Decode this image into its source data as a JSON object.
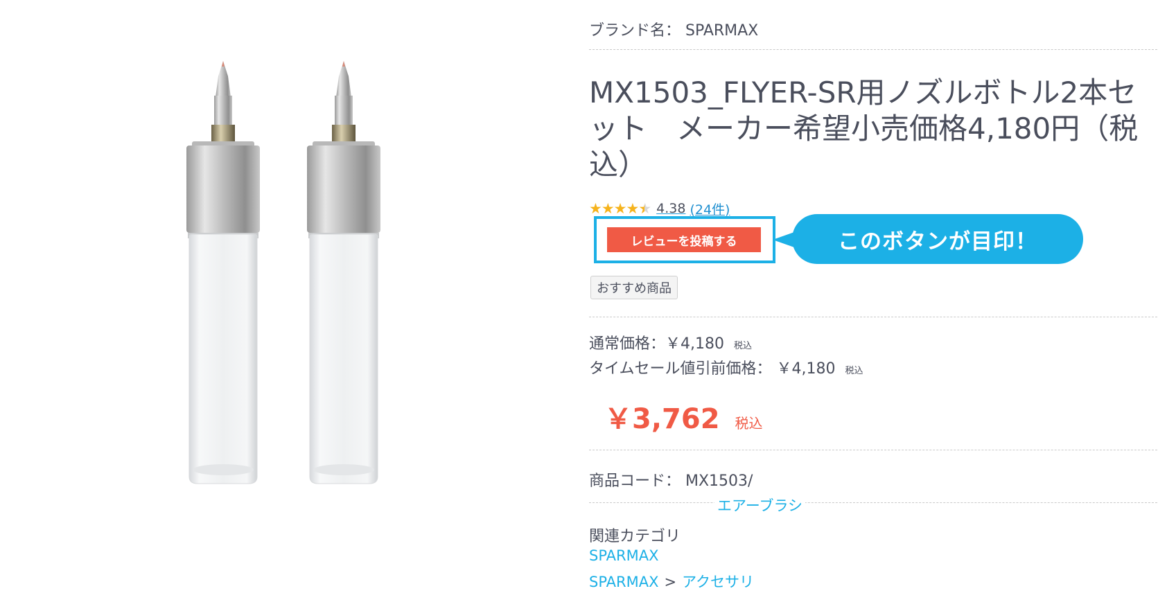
{
  "product": {
    "brand_label": "ブランド名： SPARMAX",
    "title": "MX1503_FLYER-SR用ノズルボトル2本セット　メーカー希望小売価格4,180円（税込）",
    "rating": {
      "stars": 4.38,
      "value": "4.38",
      "count": "(24件)"
    },
    "review_button": "レビューを投稿する",
    "callout": "このボタンが目印！",
    "tag": "おすすめ商品",
    "regular_price_label": "通常価格：￥4,180",
    "regular_price_tax": "税込",
    "timesale_price_label": "タイムセール値引前価格： ￥4,180",
    "timesale_price_tax": "税込",
    "sale_price": "￥3,762",
    "sale_tax": "税込",
    "product_code": "商品コード： MX1503/",
    "related_link_top": "エアーブラシ",
    "categories_heading": "関連カテゴリ",
    "category_1": "SPARMAX",
    "category_2_parent": "SPARMAX",
    "category_2_separator": ">",
    "category_2_child": "アクセサリ"
  },
  "colors": {
    "accent_red": "#f05a45",
    "accent_blue": "#1cb0e6",
    "star_gold": "#f6b31c",
    "text": "#4a4e5c"
  },
  "icons": [
    "star-icon"
  ]
}
